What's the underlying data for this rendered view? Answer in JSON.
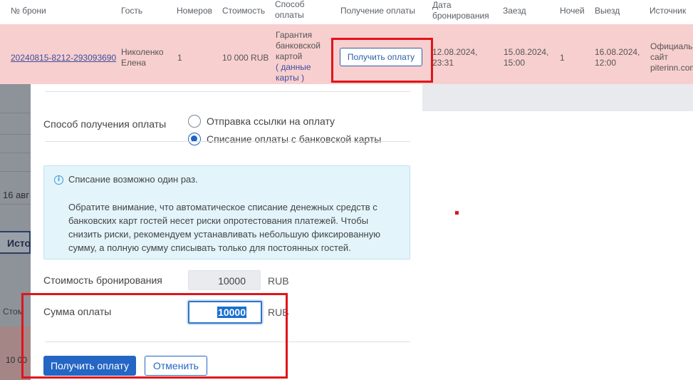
{
  "table": {
    "headers": {
      "booking_no": "№ брони",
      "guest": "Гость",
      "rooms": "Номеров",
      "cost": "Стоимость",
      "payment_method": [
        "Способ",
        "оплаты"
      ],
      "receive_payment": "Получение оплаты",
      "booking_date": [
        "Дата",
        "бронирования"
      ],
      "arrival": "Заезд",
      "nights": "Ночей",
      "departure": "Выезд",
      "source": "Источник"
    },
    "row": {
      "booking_no": "20240815-8212-293093690",
      "guest": [
        "Николенко",
        "Елена"
      ],
      "rooms": "1",
      "cost": "10 000 RUB",
      "payment_method": [
        "Гарантия",
        "банковской",
        "картой"
      ],
      "card_data_open": "(",
      "card_data_link": [
        "данные",
        "карты"
      ],
      "card_data_close": ")",
      "receive_payment_button": "Получить оплату",
      "booking_date": [
        "12.08.2024,",
        "23:31"
      ],
      "arrival": [
        "15.08.2024,",
        "15:00"
      ],
      "nights": "1",
      "departure": [
        "16.08.2024,",
        "12:00"
      ],
      "source": [
        "Официаль",
        "сайт",
        "piterinn.com"
      ]
    }
  },
  "background_fragments": {
    "date_fragment": "16 авг",
    "button_fragment": "Исто",
    "label_fragment": "Стом",
    "value_fragment": "10 00"
  },
  "modal": {
    "method_label": "Способ получения оплаты",
    "methods": [
      {
        "label": "Отправка ссылки на оплату",
        "selected": false
      },
      {
        "label": "Списание оплаты с банковской карты",
        "selected": true
      }
    ],
    "info": {
      "icon": "info-icon",
      "title": "Списание возможно один раз.",
      "body": "Обратите внимание, что автоматическое списание денежных средств с банковских карт гостей несет риски опротестования платежей. Чтобы снизить риски, рекомендуем устанавливать небольшую фиксированную сумму, а полную сумму списывать только для постоянных гостей."
    },
    "booking_cost_label": "Стоимость бронирования",
    "booking_cost_value": "10000",
    "booking_cost_unit": "RUB",
    "amount_label": "Сумма оплаты",
    "amount_value": "10000",
    "amount_unit": "RUB",
    "submit_button": "Получить оплату",
    "cancel_button": "Отменить"
  },
  "colors": {
    "row_highlight": "#f8cfcf",
    "primary": "#2466c4",
    "annotation": "#e0141b",
    "info_background": "#e3f4fb"
  }
}
